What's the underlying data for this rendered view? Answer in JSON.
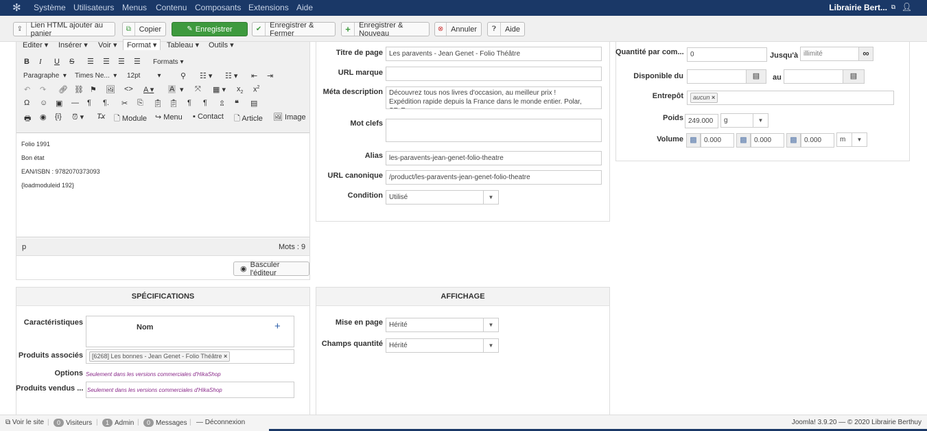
{
  "topnav": {
    "menus": [
      "Système",
      "Utilisateurs",
      "Menus",
      "Contenu",
      "Composants",
      "Extensions",
      "Aide"
    ],
    "site_name": "Librairie Bert...",
    "user_icon": "user-icon"
  },
  "toolbar": {
    "html_button": "Lien HTML ajouter au panier",
    "copy_button": "Copier",
    "save_button": "Enregistrer",
    "save_close_button": "Enregistrer & Fermer",
    "save_new_button": "Enregistrer & Nouveau",
    "cancel_button": "Annuler",
    "help_button": "Aide"
  },
  "editor": {
    "menus": [
      "Editer",
      "Insérer",
      "Voir",
      "Format",
      "Tableau",
      "Outils"
    ],
    "formats_label": "Formats",
    "paragraph_select": "Paragraphe",
    "font_select": "Times Ne...",
    "size_select": "12pt",
    "module_button": "Module",
    "menu_button": "Menu",
    "contact_button": "Contact",
    "article_button": "Article",
    "image_button": "Image",
    "lines": [
      "Folio 1991",
      "Bon état",
      "EAN/ISBN : 9782070373093",
      "{loadmoduleid 192}"
    ],
    "path": "p",
    "word_count": "Mots : 9",
    "toggle_button": "Basculer l'éditeur"
  },
  "seo": {
    "page_title_label": "Titre de page",
    "page_title_value": "Les paravents - Jean Genet - Folio Théâtre",
    "brand_url_label": "URL marque",
    "brand_url_value": "",
    "meta_desc_label": "Méta description",
    "meta_desc_value": "Découvrez tous nos livres d'occasion, au meilleur prix ! Expédition rapide depuis la France dans le monde entier. Polar, SF, Romans,",
    "keywords_label": "Mot clefs",
    "keywords_value": "",
    "alias_label": "Alias",
    "alias_value": "les-paravents-jean-genet-folio-theatre",
    "canonical_label": "URL canonique",
    "canonical_value": "/product/les-paravents-jean-genet-folio-theatre",
    "condition_label": "Condition",
    "condition_value": "Utilisé"
  },
  "stock": {
    "qty_label": "Quantité par com...",
    "qty_value": "0",
    "until_label": "Jusqu'à",
    "until_value": "illimité",
    "available_label": "Disponible du",
    "available_from": "",
    "au_label": "au",
    "available_to": "",
    "warehouse_label": "Entrepôt",
    "warehouse_tag": "aucun",
    "weight_label": "Poids",
    "weight_value": "249.000",
    "weight_unit": "g",
    "volume_label": "Volume",
    "volume_values": [
      "0.000",
      "0.000",
      "0.000"
    ],
    "volume_unit": "m"
  },
  "specs": {
    "title": "SPÉCIFICATIONS",
    "characteristics_label": "Caractéristiques",
    "name_col": "Nom",
    "related_label": "Produits associés",
    "related_tag": "[6268] Les bonnes - Jean Genet - Folio Théâtre",
    "options_label": "Options",
    "options_note": "Seulement dans les versions commerciales d'HikaShop",
    "sold_label": "Produits vendus ...",
    "sold_note": "Seulement dans les versions commerciales d'HikaShop"
  },
  "display": {
    "title": "AFFICHAGE",
    "layout_label": "Mise en page",
    "layout_value": "Hérité",
    "qty_field_label": "Champs quantité",
    "qty_field_value": "Hérité"
  },
  "footer": {
    "view_site": "Voir le site",
    "visitors_count": "0",
    "visitors_label": "Visiteurs",
    "admin_count": "1",
    "admin_label": "Admin",
    "messages_count": "0",
    "messages_label": "Messages",
    "logout": "Déconnexion",
    "version": "Joomla! 3.9.20 — © 2020 Librairie Berthuy"
  }
}
